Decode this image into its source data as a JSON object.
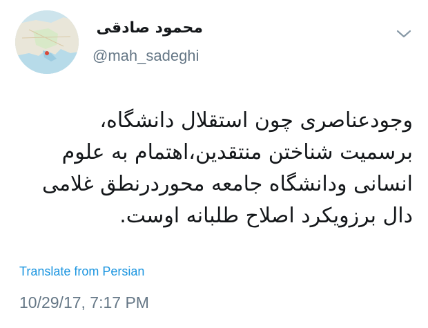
{
  "user": {
    "display_name": "محمود صادقی",
    "handle": "@mah_sadeghi"
  },
  "tweet": {
    "lines": [
      "وجودعناصری چون استقلال دانشگاه،",
      "برسمیت شناختن منتقدین،اهتمام به علوم",
      "انسانی ودانشگاه جامعه محوردرنطق غلامی",
      "دال برزویکرد اصلاح طلبانه اوست."
    ],
    "translate_label": "Translate from Persian",
    "timestamp": "10/29/17, 7:17 PM"
  },
  "icons": {
    "avatar": "map-avatar",
    "menu": "chevron-down-icon"
  },
  "colors": {
    "link": "#1b95e0",
    "secondary_text": "#657786",
    "primary_text": "#14171a"
  }
}
